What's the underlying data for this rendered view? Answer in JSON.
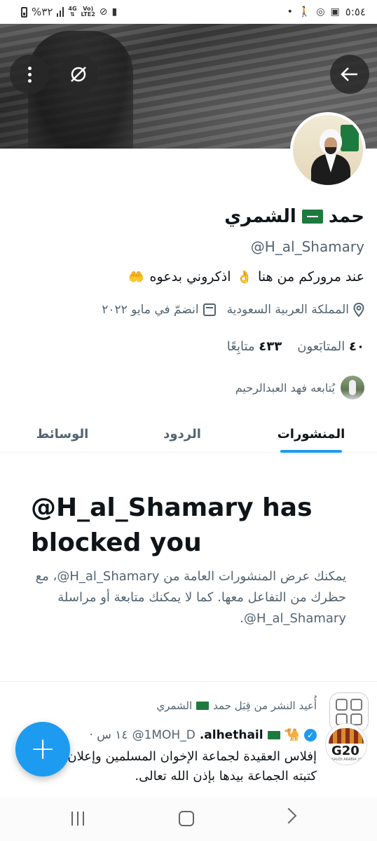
{
  "status_bar": {
    "battery": "%٣٢",
    "network": "4G",
    "network_sub": "LTE2",
    "volte": "Vo)",
    "time": "٥:٥٤"
  },
  "profile": {
    "display_name_part1": "حمد",
    "display_name_part2": "الشمري",
    "handle": "@H_al_Shamary",
    "bio_part1": "عند مروركم من هنا",
    "bio_part2": "اذكروني بدعوه",
    "location": "المملكة العربية السعودية",
    "joined": "انضمّ في مايو ٢٠٢٢",
    "followers_count": "٤٠",
    "followers_label": "المتابَعون",
    "following_count": "٤٣٣",
    "following_label": "متابِعًا",
    "followed_by": "يُتابعه فهد العبدالرحيم"
  },
  "tabs": [
    {
      "label": "المنشورات",
      "active": true
    },
    {
      "label": "الردود",
      "active": false
    },
    {
      "label": "الوسائط",
      "active": false
    }
  ],
  "blocked": {
    "title": "@H_al_Shamary has blocked you",
    "body": "يمكنك عرض المنشورات العامة من H_al_Shamary@، مع حظرك من التفاعل معها. كما لا يمكنك متابعة أو مراسلة H_al_Shamary@."
  },
  "tweet": {
    "repost_part1": "أُعيد النشر من قِبَل حمد",
    "repost_part2": "الشمري",
    "author_name": "alhethail.",
    "author_handle": "@1MOH_D",
    "meta": "· ١٤ س",
    "text_line1": "إفلاس العقيدة لجماعة الإخوان المسلمين وإعلان",
    "text_line2": "كتبته الجماعة بيدها بإذن الله تعالى.",
    "avatar_logo": "G20",
    "avatar_sub": "SAUDI ARABIA 2020"
  },
  "colors": {
    "accent": "#1d9bf0",
    "text_primary": "#0f1419",
    "text_secondary": "#536471",
    "flag_green": "#1d7a3e"
  },
  "icons": {
    "back": "arrow-left-icon",
    "more": "more-vertical-icon",
    "hide": "eye-off-icon",
    "location": "location-pin-icon",
    "calendar": "calendar-icon",
    "compose": "plus-icon",
    "verified": "verified-badge-icon"
  }
}
